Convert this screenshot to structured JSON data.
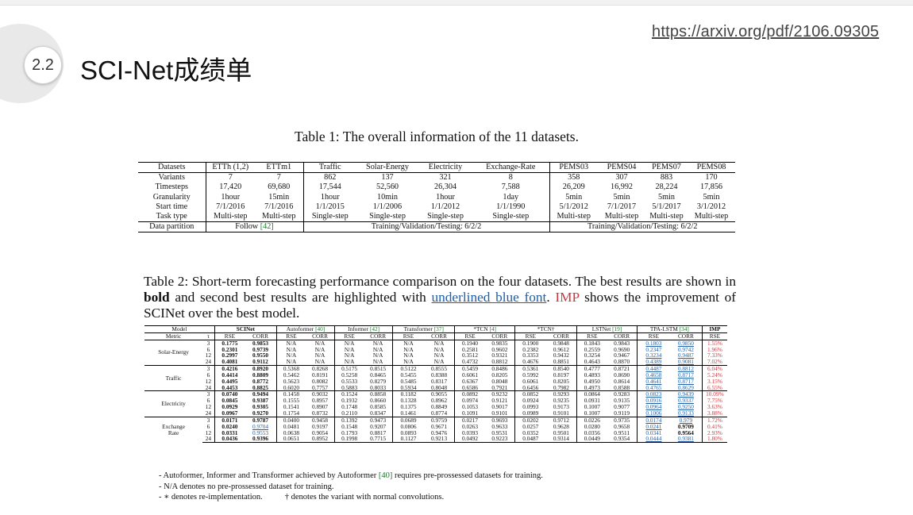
{
  "slide": {
    "url": "https://arxiv.org/pdf/2106.09305",
    "section_number": "2.2",
    "title": "SCI-Net成绩单"
  },
  "table1": {
    "caption": "Table 1: The overall information of the 11 datasets.",
    "header": [
      "Datasets",
      "ETTh (1,2)",
      "ETTm1",
      "Traffic",
      "Solar-Energy",
      "Electricity",
      "Exchange-Rate",
      "PEMS03",
      "PEMS04",
      "PEMS07",
      "PEMS08"
    ],
    "rows": [
      [
        "Variants",
        "7",
        "7",
        "862",
        "137",
        "321",
        "8",
        "358",
        "307",
        "883",
        "170"
      ],
      [
        "Timesteps",
        "17,420",
        "69,680",
        "17,544",
        "52,560",
        "26,304",
        "7,588",
        "26,209",
        "16,992",
        "28,224",
        "17,856"
      ],
      [
        "Granularity",
        "1hour",
        "15min",
        "1hour",
        "10min",
        "1hour",
        "1day",
        "5min",
        "5min",
        "5min",
        "5min"
      ],
      [
        "Start time",
        "7/1/2016",
        "7/1/2016",
        "1/1/2015",
        "1/1/2006",
        "1/1/2012",
        "1/1/1990",
        "5/1/2012",
        "7/1/2017",
        "5/1/2017",
        "3/1/2012"
      ],
      [
        "Task type",
        "Multi-step",
        "Multi-step",
        "Single-step",
        "Single-step",
        "Single-step",
        "Single-step",
        "Multi-step",
        "Multi-step",
        "Multi-step",
        "Multi-step"
      ]
    ],
    "partition": {
      "label": "Data partition",
      "ett": "Follow ",
      "ett_ref": "[42]",
      "single": "Training/Validation/Testing: 6/2/2",
      "pems": "Training/Validation/Testing: 6/2/2"
    }
  },
  "table2": {
    "caption": {
      "part1": "Table 2: Short-term forecasting performance comparison on the four datasets. The best results are shown in ",
      "bold": "bold",
      "part2": " and second best results are highlighted with ",
      "blue": "underlined blue font",
      "part3": ". ",
      "imp": "IMP",
      "part4": " shows the improvement of SCINet over the best model."
    },
    "model_header": {
      "model": "Model",
      "scinet": "SCINet",
      "autoformer": "Autoformer ",
      "autoformer_ref": "[40]",
      "informer": "Informer ",
      "informer_ref": "[42]",
      "transformer": "Transformer ",
      "transformer_ref": "[37]",
      "tcn_star": "*TCN ",
      "tcn_star_ref": "[4]",
      "tcn_dag": "*TCN†",
      "lstnet": "LSTNet ",
      "lstnet_ref": "[19]",
      "tpa": "TPA-LSTM ",
      "tpa_ref": "[34]",
      "imp": "IMP"
    },
    "metric_header": [
      "Metric",
      "τ",
      "RSE",
      "CORR",
      "RSE",
      "CORR",
      "RSE",
      "CORR",
      "RSE",
      "CORR",
      "RSE",
      "CORR",
      "RSE",
      "CORR",
      "RSE",
      "CORR",
      "RSE",
      "CORR",
      "RSE"
    ],
    "groups": [
      {
        "name": "Solar-Energy",
        "rows": [
          [
            "3",
            "0.1775",
            "0.9853",
            "N/A",
            "N/A",
            "N/A",
            "N/A",
            "N/A",
            "N/A",
            "0.1940",
            "0.9835",
            "0.1900",
            "0.9848",
            "0.1843",
            "0.9843",
            "0.1803",
            "0.9850",
            "1.55%"
          ],
          [
            "6",
            "0.2301",
            "0.9739",
            "N/A",
            "N/A",
            "N/A",
            "N/A",
            "N/A",
            "N/A",
            "0.2581",
            "0.9602",
            "0.2382",
            "0.9612",
            "0.2559",
            "0.9690",
            "0.2347",
            "0.9742",
            "1.96%"
          ],
          [
            "12",
            "0.2997",
            "0.9550",
            "N/A",
            "N/A",
            "N/A",
            "N/A",
            "N/A",
            "N/A",
            "0.3512",
            "0.9321",
            "0.3353",
            "0.9432",
            "0.3254",
            "0.9467",
            "0.3234",
            "0.9487",
            "7.33%"
          ],
          [
            "24",
            "0.4081",
            "0.9112",
            "N/A",
            "N/A",
            "N/A",
            "N/A",
            "N/A",
            "N/A",
            "0.4732",
            "0.8812",
            "0.4676",
            "0.8851",
            "0.4643",
            "0.8870",
            "0.4389",
            "0.9081",
            "7.02%"
          ]
        ]
      },
      {
        "name": "Traffic",
        "rows": [
          [
            "3",
            "0.4216",
            "0.8920",
            "0.5368",
            "0.8268",
            "0.5175",
            "0.8515",
            "0.5122",
            "0.8555",
            "0.5459",
            "0.8486",
            "0.5361",
            "0.8540",
            "0.4777",
            "0.8721",
            "0.4487",
            "0.8812",
            "6.04%"
          ],
          [
            "6",
            "0.4414",
            "0.8809",
            "0.5462",
            "0.8191",
            "0.5258",
            "0.8465",
            "0.5455",
            "0.8388",
            "0.6061",
            "0.8205",
            "0.5992",
            "0.8197",
            "0.4893",
            "0.8690",
            "0.4658",
            "0.8717",
            "5.24%"
          ],
          [
            "12",
            "0.4495",
            "0.8772",
            "0.5623",
            "0.8082",
            "0.5533",
            "0.8279",
            "0.5485",
            "0.8317",
            "0.6367",
            "0.8048",
            "0.6061",
            "0.8205",
            "0.4950",
            "0.8614",
            "0.4641",
            "0.8717",
            "3.15%"
          ],
          [
            "24",
            "0.4453",
            "0.8825",
            "0.6020",
            "0.7757",
            "0.5883",
            "0.8033",
            "0.5934",
            "0.8048",
            "0.6586",
            "0.7921",
            "0.6456",
            "0.7982",
            "0.4973",
            "0.8588",
            "0.4765",
            "0.8629",
            "6.55%"
          ]
        ]
      },
      {
        "name": "Electricity",
        "rows": [
          [
            "3",
            "0.0740",
            "0.9494",
            "0.1458",
            "0.9032",
            "0.1524",
            "0.8858",
            "0.1182",
            "0.9055",
            "0.0892",
            "0.9232",
            "0.0852",
            "0.9293",
            "0.0864",
            "0.9283",
            "0.0823",
            "0.9439",
            "10.09%"
          ],
          [
            "6",
            "0.0845",
            "0.9387",
            "0.1555",
            "0.8957",
            "0.1932",
            "0.8660",
            "0.1328",
            "0.8962",
            "0.0974",
            "0.9121",
            "0.0924",
            "0.9235",
            "0.0931",
            "0.9135",
            "0.0916",
            "0.9337",
            "7.75%"
          ],
          [
            "12",
            "0.0929",
            "0.9305",
            "0.1541",
            "0.8907",
            "0.1748",
            "0.8585",
            "0.1375",
            "0.8849",
            "0.1053",
            "0.9017",
            "0.0993",
            "0.9173",
            "0.1007",
            "0.9077",
            "0.0964",
            "0.9250",
            "3.63%"
          ],
          [
            "24",
            "0.0967",
            "0.9270",
            "0.1754",
            "0.8732",
            "0.2110",
            "0.8347",
            "0.1461",
            "0.8774",
            "0.1091",
            "0.9101",
            "0.0989",
            "0.9101",
            "0.1007",
            "0.9119",
            "0.1006",
            "0.9133",
            "3.88%"
          ]
        ]
      },
      {
        "name_line1": "Exchange",
        "name_line2": "Rate",
        "rows": [
          [
            "3",
            "0.0171",
            "0.9787",
            "0.0400",
            "0.9458",
            "0.1392",
            "0.9473",
            "0.0689",
            "0.9759",
            "0.0217",
            "0.9693",
            "0.0202",
            "0.9712",
            "0.0226",
            "0.9735",
            "0.0174",
            "0.979",
            "1.72%"
          ],
          [
            "6",
            "0.0240",
            "0.9704",
            "0.0481",
            "0.9197",
            "0.1548",
            "0.9207",
            "0.0806",
            "0.9671",
            "0.0263",
            "0.9633",
            "0.0257",
            "0.9628",
            "0.0280",
            "0.9658",
            "0.0241",
            "0.9709",
            "0.41%"
          ],
          [
            "12",
            "0.0331",
            "0.9553",
            "0.0638",
            "0.9054",
            "0.1793",
            "0.8817",
            "0.0893",
            "0.9476",
            "0.0393",
            "0.9531",
            "0.0352",
            "0.9501",
            "0.0356",
            "0.9511",
            "0.0341",
            "0.9564",
            "2.93%"
          ],
          [
            "24",
            "0.0436",
            "0.9396",
            "0.0651",
            "0.8952",
            "0.1998",
            "0.7715",
            "0.1127",
            "0.9213",
            "0.0492",
            "0.9223",
            "0.0487",
            "0.9314",
            "0.0449",
            "0.9354",
            "0.0444",
            "0.9381",
            "1.80%"
          ]
        ]
      }
    ],
    "notes": {
      "n1_a": "- Autoformer, Informer and Transformer achieved by Autoformer ",
      "n1_ref": "[40]",
      "n1_b": " requires pre-prossessed datasets for training.",
      "n2": "- N/A denotes no pre-prossessed dataset for training.",
      "n3_a": "- ∗ denotes re-implementation.",
      "n3_b": "† denotes the variant with normal convolutions."
    }
  }
}
